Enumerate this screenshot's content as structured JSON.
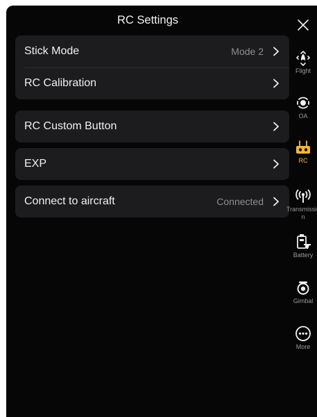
{
  "header": {
    "title": "RC Settings"
  },
  "groups": [
    {
      "rows": [
        {
          "label": "Stick Mode",
          "value": "Mode 2"
        },
        {
          "label": "RC Calibration",
          "value": ""
        }
      ]
    },
    {
      "rows": [
        {
          "label": "RC Custom Button",
          "value": ""
        }
      ]
    },
    {
      "rows": [
        {
          "label": "EXP",
          "value": ""
        }
      ]
    },
    {
      "rows": [
        {
          "label": "Connect to aircraft",
          "value": "Connected"
        }
      ]
    }
  ],
  "sidebar": {
    "items": [
      {
        "label": "Flight",
        "icon": "flight-icon"
      },
      {
        "label": "OA",
        "icon": "obstacle-avoidance-icon"
      },
      {
        "label": "RC",
        "icon": "remote-controller-icon",
        "active": true
      },
      {
        "label": "Transmission",
        "icon": "transmission-icon"
      },
      {
        "label": "Battery",
        "icon": "battery-icon"
      },
      {
        "label": "Gimbal",
        "icon": "gimbal-icon"
      },
      {
        "label": "More",
        "icon": "more-icon"
      }
    ]
  },
  "colors": {
    "accent": "#f5b820",
    "panel": "#060606",
    "row": "#1c1c1e",
    "text": "#f0f0f0",
    "muted": "#8e8e93"
  }
}
